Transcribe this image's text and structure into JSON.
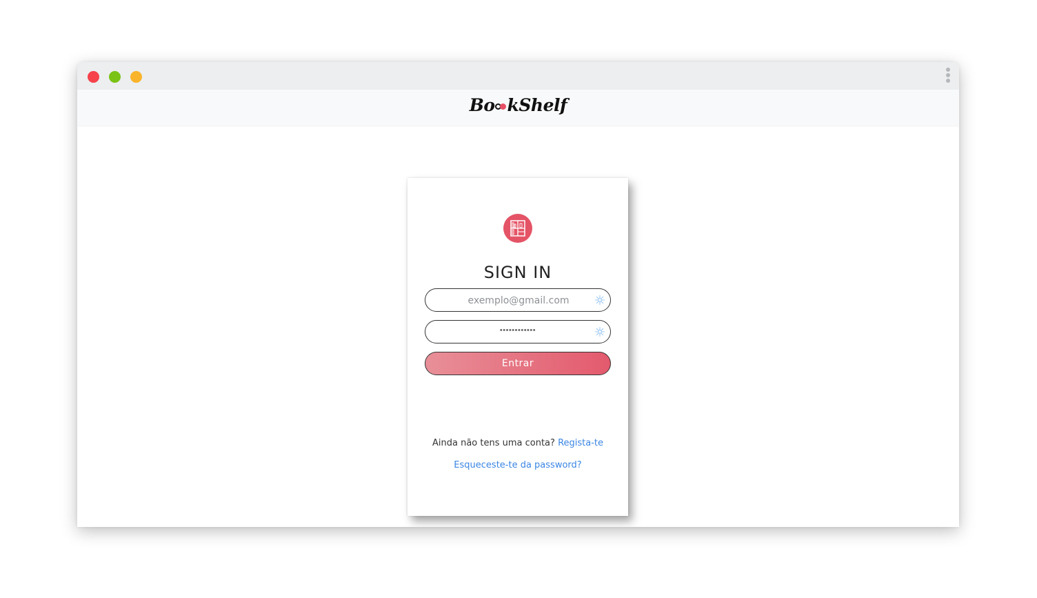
{
  "app": {
    "brand": {
      "prefix": "Bo",
      "suffix": "kShelf"
    }
  },
  "window": {
    "controls": [
      "close",
      "maximize",
      "minimize"
    ],
    "menu_icon": "kebab-menu-icon"
  },
  "signin": {
    "logo_icon": "bookshelf-icon",
    "title": "SIGN IN",
    "email": {
      "placeholder": "exemplo@gmail.com",
      "value": ""
    },
    "password": {
      "masked_value": "••••••••••••"
    },
    "field_icon": "sparkle-icon",
    "submit_label": "Entrar",
    "signup_prompt": "Ainda não tens uma conta?",
    "signup_link": "Regista-te",
    "forgot_link": "Esqueceste-te da password?"
  },
  "colors": {
    "accent": "#e45466",
    "link": "#3b86e3",
    "close": "#f5424b",
    "maximize": "#7ac216",
    "minimize": "#f9b42b"
  }
}
